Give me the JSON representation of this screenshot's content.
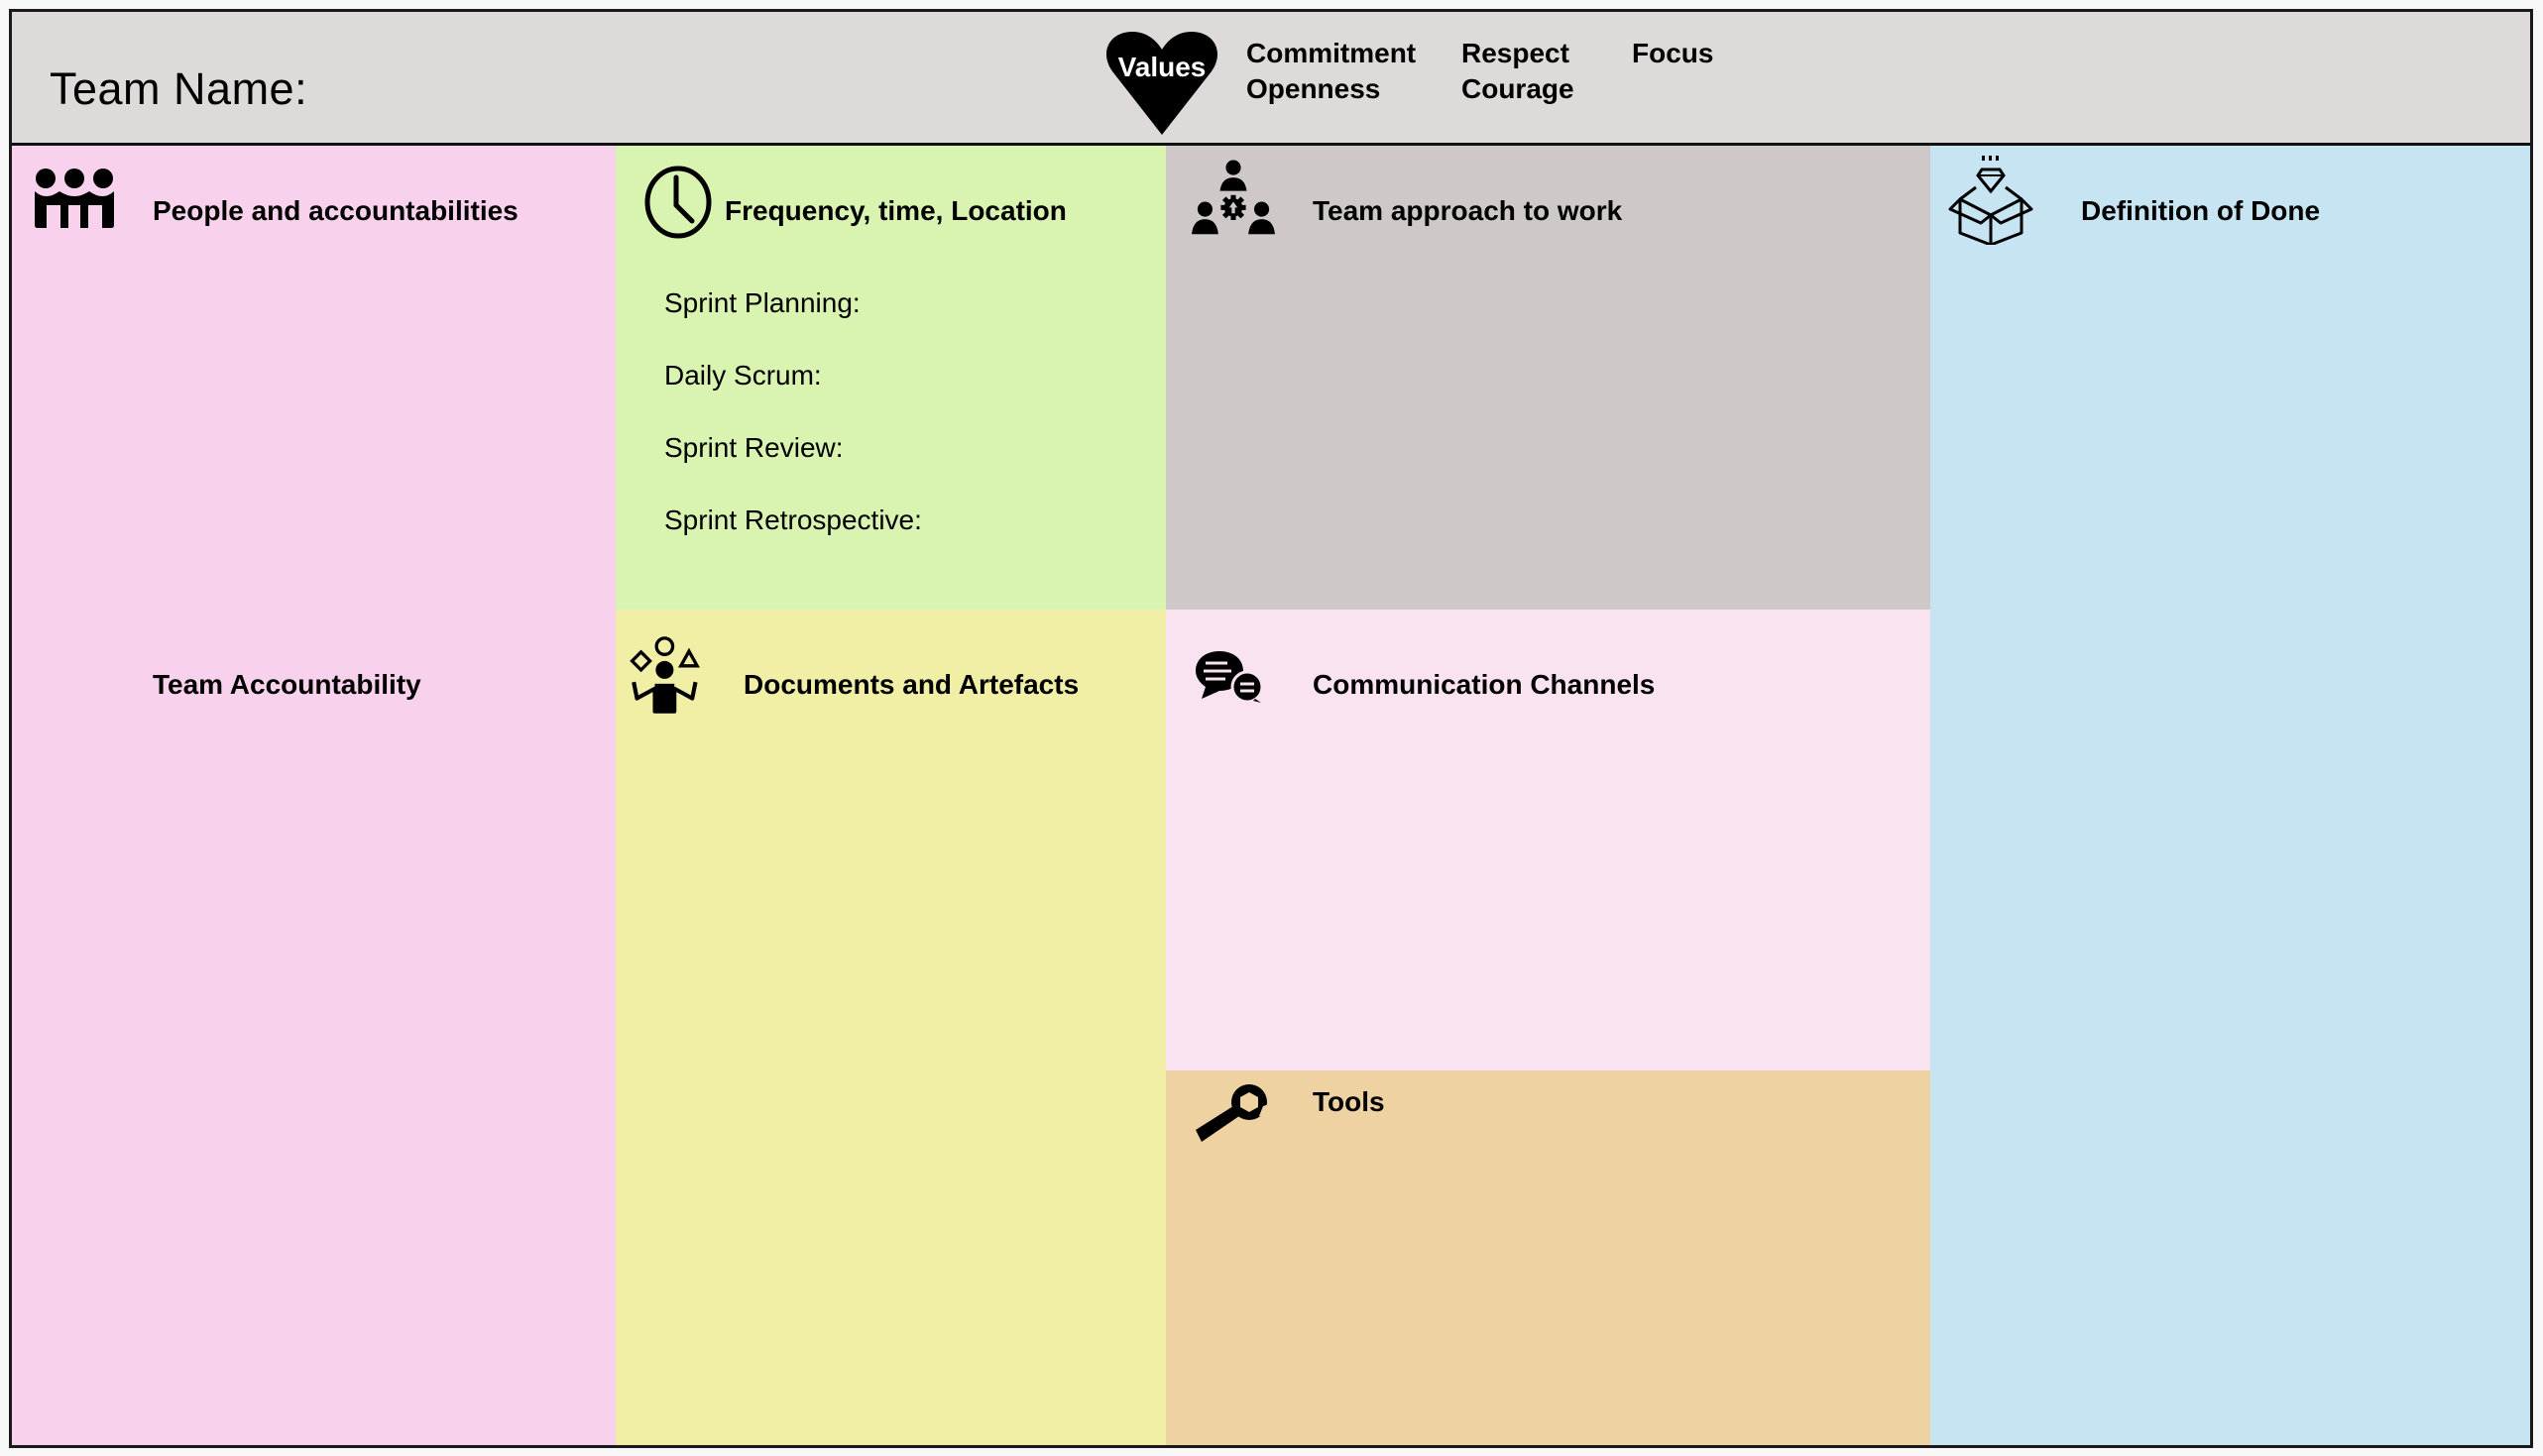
{
  "header": {
    "team_name_label": "Team Name:",
    "values_label": "Values",
    "values": [
      "Commitment",
      "Openness",
      "Respect",
      "Courage",
      "Focus"
    ]
  },
  "panels": {
    "people": {
      "title": "People and accountabilities",
      "icon": "people-group-icon",
      "color": "#f8d2ec"
    },
    "team_accountability": {
      "title": "Team Accountability"
    },
    "frequency": {
      "title": "Frequency, time, Location",
      "icon": "clock-icon",
      "color": "#d8f4b0",
      "items": [
        "Sprint Planning:",
        "Daily Scrum:",
        "Sprint Review:",
        "Sprint Retrospective:"
      ]
    },
    "approach": {
      "title": "Team approach to work",
      "icon": "team-gear-icon",
      "color": "#cfc8c8"
    },
    "definition_of_done": {
      "title": "Definition of Done",
      "icon": "box-diamond-icon",
      "color": "#c7e4f2"
    },
    "documents": {
      "title": "Documents and Artefacts",
      "icon": "juggling-person-icon",
      "color": "#f1eea6"
    },
    "communication": {
      "title": "Communication Channels",
      "icon": "chat-bubbles-icon",
      "color": "#fae3f1"
    },
    "tools": {
      "title": "Tools",
      "icon": "wrench-icon",
      "color": "#efd2a2"
    }
  }
}
